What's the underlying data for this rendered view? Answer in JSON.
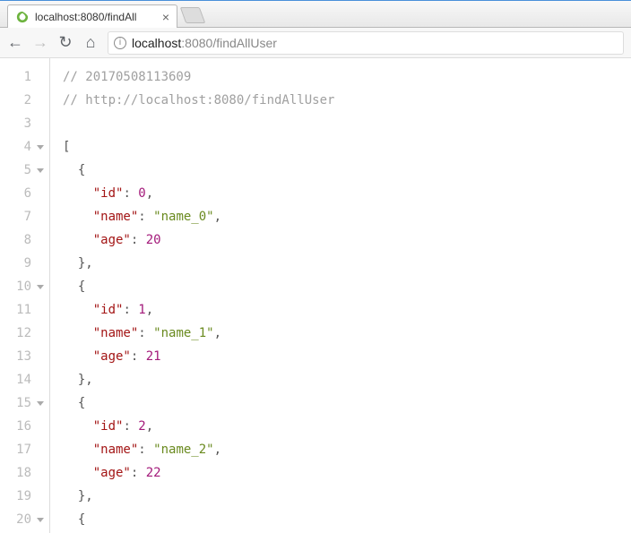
{
  "tab": {
    "title": "localhost:8080/findAll"
  },
  "url": {
    "host": "localhost",
    "port": ":8080",
    "path": "/findAllUser"
  },
  "code": {
    "comment_timestamp": "// 20170508113609",
    "comment_url": "// http://localhost:8080/findAllUser",
    "key_id": "\"id\"",
    "key_name": "\"name\"",
    "key_age": "\"age\"",
    "obj0": {
      "id": "0",
      "name": "\"name_0\"",
      "age": "20"
    },
    "obj1": {
      "id": "1",
      "name": "\"name_1\"",
      "age": "21"
    },
    "obj2": {
      "id": "2",
      "name": "\"name_2\"",
      "age": "22"
    }
  },
  "gutter": {
    "l1": "1",
    "l2": "2",
    "l3": "3",
    "l4": "4",
    "l5": "5",
    "l6": "6",
    "l7": "7",
    "l8": "8",
    "l9": "9",
    "l10": "10",
    "l11": "11",
    "l12": "12",
    "l13": "13",
    "l14": "14",
    "l15": "15",
    "l16": "16",
    "l17": "17",
    "l18": "18",
    "l19": "19",
    "l20": "20"
  }
}
